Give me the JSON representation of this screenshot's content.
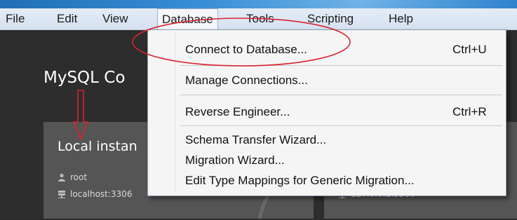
{
  "menubar": {
    "items": [
      {
        "label": "File"
      },
      {
        "label": "Edit"
      },
      {
        "label": "View"
      },
      {
        "label": "Database"
      },
      {
        "label": "Tools"
      },
      {
        "label": "Scripting"
      },
      {
        "label": "Help"
      }
    ]
  },
  "dropdown": {
    "items": [
      {
        "label": "Connect to Database...",
        "shortcut": "Ctrl+U"
      },
      {
        "label": "Manage Connections...",
        "shortcut": ""
      },
      {
        "label": "Reverse Engineer...",
        "shortcut": "Ctrl+R"
      },
      {
        "label": "Schema Transfer Wizard...",
        "shortcut": ""
      },
      {
        "label": "Migration Wizard...",
        "shortcut": ""
      },
      {
        "label": "Edit Type Mappings for Generic Migration...",
        "shortcut": ""
      }
    ]
  },
  "main": {
    "title": "MySQL Co",
    "cards": [
      {
        "title": "Local instan",
        "user": "root",
        "host": "localhost:3306"
      },
      {
        "title": "",
        "user": "",
        "host": "127.0.0.1:3306"
      }
    ]
  },
  "colors": {
    "annotation": "#d9232e",
    "menubar_bg": "#dbe5f3",
    "dropdown_bg": "#f5f5f5",
    "app_bg": "#2d2d2d",
    "card_bg": "#555555"
  },
  "icons": {
    "user": "user-icon",
    "host": "server-icon",
    "arrow": "arrow-down-icon"
  }
}
